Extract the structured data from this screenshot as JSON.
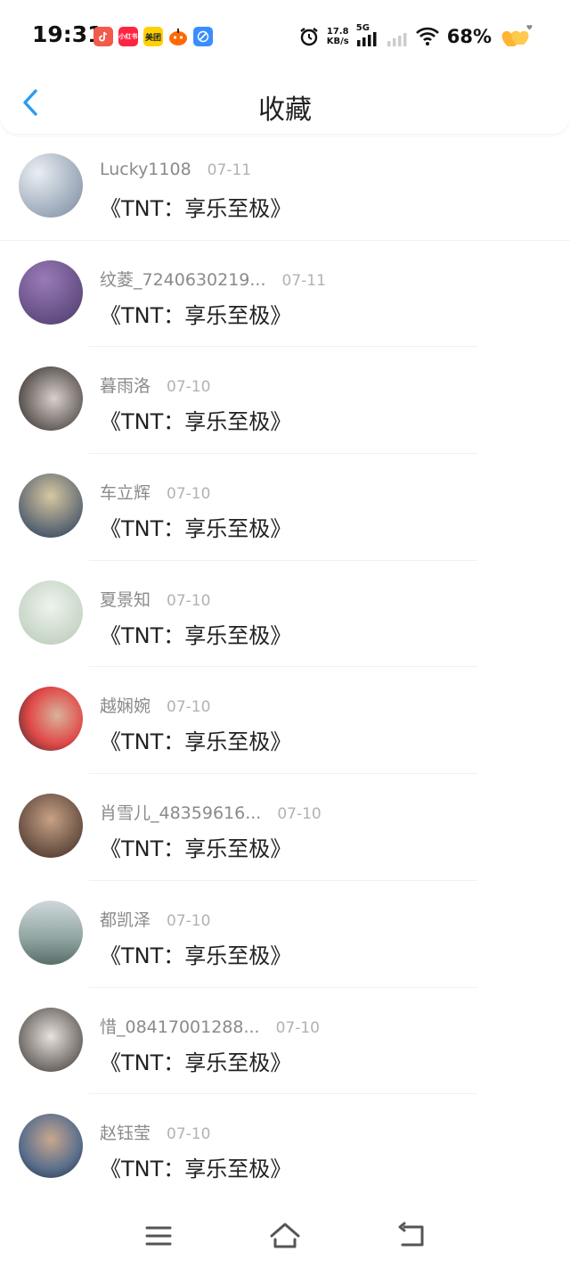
{
  "status_bar": {
    "time": "19:31",
    "apps": [
      {
        "label": "",
        "color": "#f25a4b",
        "icon": "douyin-icon"
      },
      {
        "label": "小红书",
        "color": "#ff2442",
        "icon": "xiaohongshu-icon"
      },
      {
        "label": "美团",
        "color": "#ffd100",
        "icon": "meituan-icon"
      },
      {
        "label": "",
        "color": "#ff6a00",
        "icon": "pumpkin-icon"
      },
      {
        "label": "",
        "color": "#3a8dff",
        "icon": "browser-icon"
      }
    ],
    "net_speed_value": "17.8",
    "net_speed_unit": "KB/s",
    "network": "5G",
    "battery": "68%"
  },
  "header": {
    "title": "收藏",
    "accent_color": "#2b9cf0"
  },
  "items": [
    {
      "user": "Lucky1108",
      "date": "07-11",
      "title": "《TNT：享乐至极》",
      "avatar_colors": [
        "#e9eef3",
        "#7a8aa0"
      ]
    },
    {
      "user": "纹菱_7240630219...",
      "date": "07-11",
      "title": "《TNT：享乐至极》",
      "avatar_colors": [
        "#9a7bb8",
        "#4b3a6a"
      ]
    },
    {
      "user": "暮雨洛",
      "date": "07-10",
      "title": "《TNT：享乐至极》",
      "avatar_colors": [
        "#d8d0cb",
        "#2b2523"
      ]
    },
    {
      "user": "车立辉",
      "date": "07-10",
      "title": "《TNT：享乐至极》",
      "avatar_colors": [
        "#d7c7a1",
        "#233a5c"
      ]
    },
    {
      "user": "夏景知",
      "date": "07-10",
      "title": "《TNT：享乐至极》",
      "avatar_colors": [
        "#eef3ee",
        "#b7c9b5"
      ]
    },
    {
      "user": "越娴婉",
      "date": "07-10",
      "title": "《TNT：享乐至极》",
      "avatar_colors": [
        "#e04848",
        "#2a2a2a"
      ]
    },
    {
      "user": "肖雪儿_48359616...",
      "date": "07-10",
      "title": "《TNT：享乐至极》",
      "avatar_colors": [
        "#c8a187",
        "#3b2a21"
      ]
    },
    {
      "user": "都凯泽",
      "date": "07-10",
      "title": "《TNT：享乐至极》",
      "avatar_colors": [
        "#cfd8dc",
        "#596e6a"
      ]
    },
    {
      "user": "惜_08417001288...",
      "date": "07-10",
      "title": "《TNT：享乐至极》",
      "avatar_colors": [
        "#e7e2de",
        "#3c3632"
      ]
    },
    {
      "user": "赵钰莹",
      "date": "07-10",
      "title": "《TNT：享乐至极》",
      "avatar_colors": [
        "#5a6f8c",
        "#1e2735"
      ]
    }
  ],
  "nav": {
    "icon_color": "#555555",
    "icons": [
      "menu-icon",
      "home-icon",
      "back-nav-icon"
    ]
  }
}
